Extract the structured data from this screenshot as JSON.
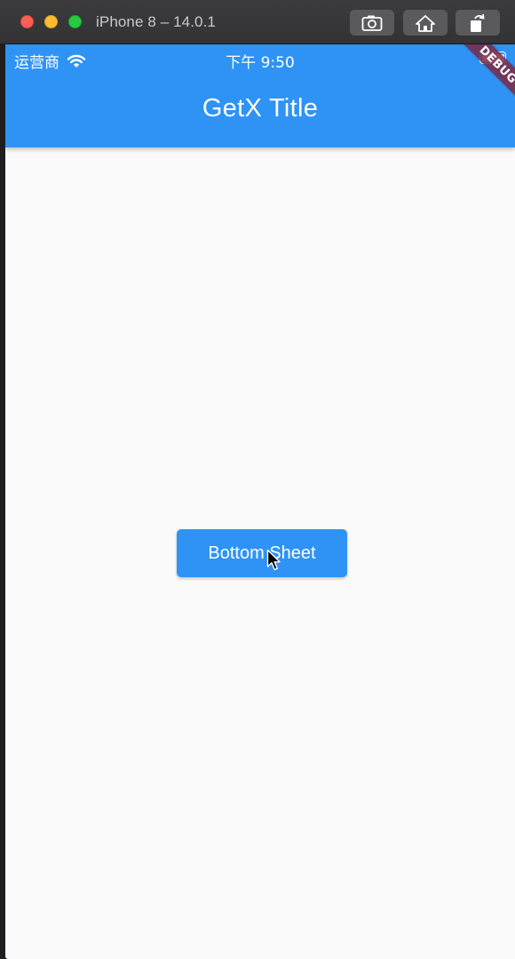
{
  "window": {
    "title": "iPhone 8 – 14.0.1"
  },
  "status_bar": {
    "carrier": "运营商",
    "time": "下午 9:50",
    "wifi_icon": "wifi-icon",
    "battery_icon": "battery-icon"
  },
  "app_bar": {
    "title": "GetX Title"
  },
  "debug_banner": {
    "label": "DEBUG"
  },
  "body": {
    "button_label": "Bottom Sheet"
  },
  "colors": {
    "primary": "#2e93f5",
    "background": "#fafafa",
    "debug": "#7a2842"
  }
}
